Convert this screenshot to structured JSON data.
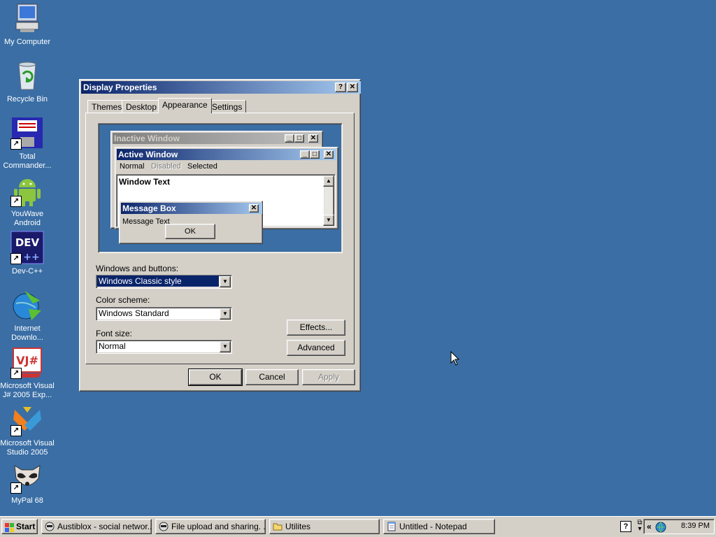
{
  "desktop": {
    "icons": [
      {
        "label": "My Computer"
      },
      {
        "label": "Recycle Bin"
      },
      {
        "label": "Total Commander..."
      },
      {
        "label": "YouWave Android"
      },
      {
        "label": "Dev-C++"
      },
      {
        "label": "Internet Downlo..."
      },
      {
        "label": "Microsoft Visual J# 2005 Exp..."
      },
      {
        "label": "Microsoft Visual Studio 2005"
      },
      {
        "label": "MyPal 68"
      }
    ]
  },
  "dialog": {
    "title": "Display Properties",
    "help_glyph": "?",
    "close_glyph": "✕",
    "tabs": [
      {
        "label": "Themes"
      },
      {
        "label": "Desktop"
      },
      {
        "label": "Appearance"
      },
      {
        "label": "Settings"
      }
    ],
    "preview": {
      "inactive_title": "Inactive Window",
      "active_title": "Active Window",
      "menu_normal": "Normal",
      "menu_disabled": "Disabled",
      "menu_selected": "Selected",
      "window_text": "Window Text",
      "message_box_title": "Message Box",
      "message_text": "Message Text",
      "ok_label": "OK"
    },
    "windows_buttons_label": "Windows and buttons:",
    "windows_buttons_value": "Windows Classic style",
    "color_scheme_label": "Color scheme:",
    "color_scheme_value": "Windows Standard",
    "font_size_label": "Font size:",
    "font_size_value": "Normal",
    "effects_label": "Effects...",
    "advanced_label": "Advanced",
    "ok_label": "OK",
    "cancel_label": "Cancel",
    "apply_label": "Apply"
  },
  "taskbar": {
    "start_label": "Start",
    "tasks": [
      {
        "label": "Austiblox - social networ..."
      },
      {
        "label": "File upload and sharing. ..."
      },
      {
        "label": "Utilites"
      },
      {
        "label": "Untitled - Notepad"
      }
    ],
    "clock": "8:39 PM",
    "help_glyph": "?"
  },
  "colors": {
    "desktop": "#3a6ea5",
    "face": "#d4d0c8",
    "active_title_start": "#0a246a",
    "active_title_end": "#a6caf0",
    "inactive_title_start": "#808080",
    "inactive_title_end": "#c0c0c0",
    "selection": "#0a246a"
  }
}
